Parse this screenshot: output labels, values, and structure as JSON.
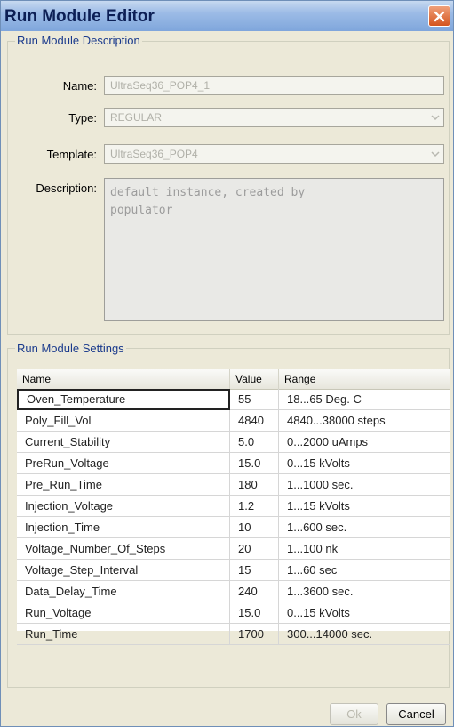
{
  "window": {
    "title": "Run Module Editor"
  },
  "description_group": {
    "label": "Run Module Description",
    "name_label": "Name:",
    "name_value": "UltraSeq36_POP4_1",
    "type_label": "Type:",
    "type_value": "REGULAR",
    "template_label": "Template:",
    "template_value": "UltraSeq36_POP4",
    "description_label": "Description:",
    "description_value": "default instance, created by\npopulator"
  },
  "settings_group": {
    "label": "Run Module Settings",
    "columns": [
      "Name",
      "Value",
      "Range"
    ],
    "rows": [
      {
        "name": "Oven_Temperature",
        "value": "55",
        "range": "18...65 Deg. C"
      },
      {
        "name": "Poly_Fill_Vol",
        "value": "4840",
        "range": "4840...38000 steps"
      },
      {
        "name": "Current_Stability",
        "value": "5.0",
        "range": "0...2000 uAmps"
      },
      {
        "name": "PreRun_Voltage",
        "value": "15.0",
        "range": "0...15 kVolts"
      },
      {
        "name": "Pre_Run_Time",
        "value": "180",
        "range": "1...1000 sec."
      },
      {
        "name": "Injection_Voltage",
        "value": "1.2",
        "range": "1...15 kVolts"
      },
      {
        "name": "Injection_Time",
        "value": "10",
        "range": "1...600 sec."
      },
      {
        "name": "Voltage_Number_Of_Steps",
        "value": "20",
        "range": "1...100 nk"
      },
      {
        "name": "Voltage_Step_Interval",
        "value": "15",
        "range": "1...60 sec"
      },
      {
        "name": "Data_Delay_Time",
        "value": "240",
        "range": "1...3600 sec."
      },
      {
        "name": "Run_Voltage",
        "value": "15.0",
        "range": "0...15 kVolts"
      },
      {
        "name": "Run_Time",
        "value": "1700",
        "range": "300...14000 sec."
      }
    ]
  },
  "buttons": {
    "ok": "Ok",
    "cancel": "Cancel"
  }
}
